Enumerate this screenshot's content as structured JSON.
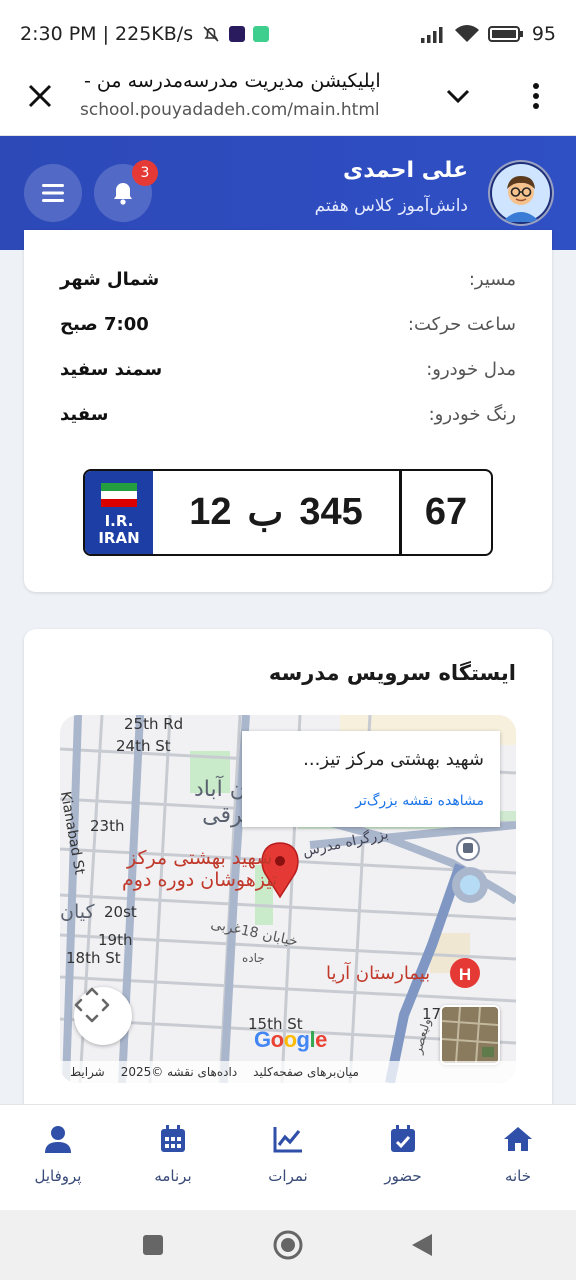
{
  "status_bar": {
    "time": "2:30 PM | 225KB/s",
    "battery": "95"
  },
  "browser": {
    "page_title": "اپلیکیشن مدیریت مدرسه‌مدرسه من -",
    "url": "school.pouyadadeh.com/main.html"
  },
  "header": {
    "user_name": "علی احمدی",
    "user_role": "دانش‌آموز کلاس هفتم",
    "notification_count": "3"
  },
  "vehicle": {
    "route_label": "مسیر:",
    "route_value": "شمال شهر",
    "departure_label": "ساعت حرکت:",
    "departure_value": "7:00 صبح",
    "model_label": "مدل خودرو:",
    "model_value": "سمند سفید",
    "color_label": "رنگ خودرو:",
    "color_value": "سفید"
  },
  "plate": {
    "country_line1": "I.R.",
    "country_line2": "IRAN",
    "number_left": "12",
    "letter": "ب",
    "number_right": "345",
    "region": "67"
  },
  "station": {
    "title": "ایستگاه سرویس مدرسه",
    "place_title": "شهید بهشتی مرکز تیز...",
    "larger_map_link": "مشاهده نقشه بزرگ‌تر",
    "marker_label_1": "شهید بهشتی مرکز",
    "marker_label_2": "تیزهوشان دوره دوم",
    "hospital_label": "بیمارستان آریا",
    "district_1": "کیان آباد",
    "district_2": "شرقی",
    "district_3": "کیان",
    "highway_label": "بزرگراه مدرس",
    "street_18_label": "خیابان 18غربی",
    "jaddeh_label": "جاده",
    "valiasr_label": "ولیعصر",
    "street_25th": "25th Rd",
    "street_24th": "24th St",
    "street_23th": "23th",
    "street_20st": "20st",
    "street_19th": "19th",
    "street_18th": "18th St",
    "street_15th": "15th St",
    "street_17": "17",
    "street_kianabad": "Kianabad St",
    "google_letters": [
      "G",
      "o",
      "o",
      "g",
      "l",
      "e"
    ],
    "attribution_1": "میان‌برهای صفحه‌کلید",
    "attribution_2": "داده‌های نقشه ©2025",
    "attribution_3": "شرایط"
  },
  "bottom_nav": {
    "home": "خانه",
    "attendance": "حضور",
    "grades": "نمرات",
    "schedule": "برنامه",
    "profile": "پروفایل"
  },
  "colors": {
    "header_blue": "#2f4fc4",
    "plate_blue": "#1c3ea5",
    "badge_red": "#e53935",
    "nav_icon": "#2f4fa8",
    "marker_red": "#e53935"
  }
}
